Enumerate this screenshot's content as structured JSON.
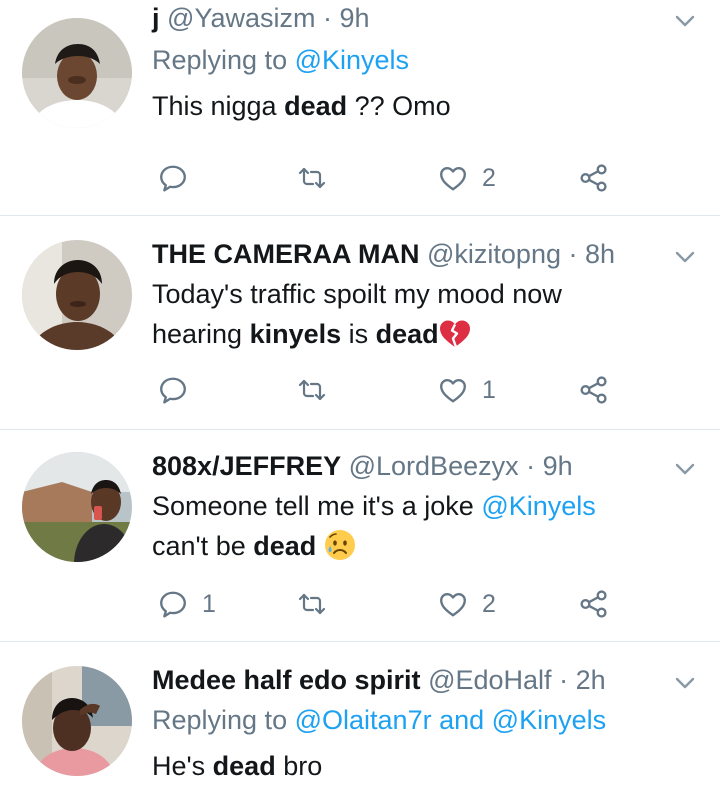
{
  "tweets": [
    {
      "name": "ϳ",
      "handle": "@Yawasizm",
      "dot": "·",
      "time": "9h",
      "replying_prefix": "Replying to",
      "replying_mentions": [
        "@Kinyels"
      ],
      "replying_joiner": "",
      "text": {
        "t1": "This nigga ",
        "b1": "dead",
        "t2": " ?? Omo"
      },
      "reply_count": "",
      "retweet_count": "",
      "like_count": "2"
    },
    {
      "name": "THE CAMERAA MAN",
      "handle": "@kizitopng",
      "dot": "·",
      "time": "8h",
      "text": {
        "l1": "Today's  traffic spoilt my mood now",
        "t1": "hearing ",
        "b1": "kinyels",
        "t2": " is ",
        "b2": "dead",
        "emoji": "broken-heart-emoji"
      },
      "reply_count": "",
      "retweet_count": "",
      "like_count": "1"
    },
    {
      "name": "808x/JEFFREY",
      "handle": "@LordBeezyx",
      "dot": "·",
      "time": "9h",
      "text": {
        "t1": "Someone tell me it's a joke ",
        "m1": "@Kinyels",
        "t2": "can't be ",
        "b1": "dead",
        "emoji": "sad-sweat-face-emoji"
      },
      "reply_count": "1",
      "retweet_count": "",
      "like_count": "2"
    },
    {
      "name": "Medee half edo spirit",
      "handle": "@EdoHalf",
      "dot": "·",
      "time": "2h",
      "replying_prefix": "Replying to",
      "replying_mentions": [
        "@Olaitan7r",
        "@Kinyels"
      ],
      "replying_joiner": "and",
      "text": {
        "t1": "He's ",
        "b1": "dead",
        "t2": " bro"
      }
    }
  ],
  "icons": {
    "reply": "reply-icon",
    "retweet": "retweet-icon",
    "like": "heart-icon",
    "share": "share-icon",
    "menu": "chevron-down-icon"
  },
  "colors": {
    "text": "#14171a",
    "secondary": "#657786",
    "link": "#1da1f2",
    "divider": "#e1e8ed"
  }
}
